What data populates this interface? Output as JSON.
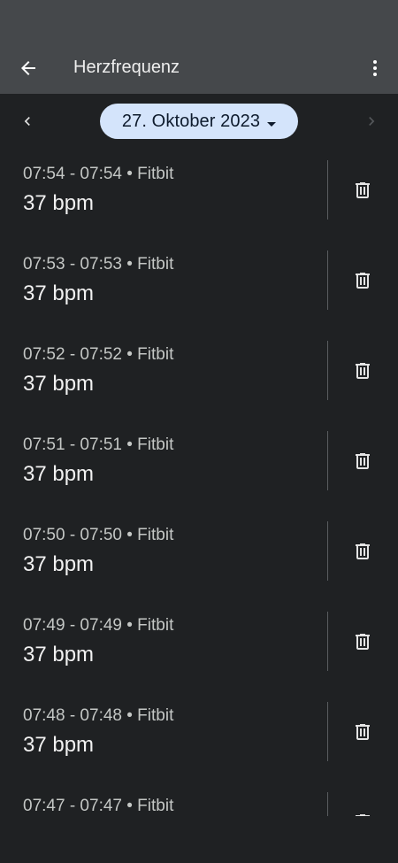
{
  "app_bar": {
    "title": "Herzfrequenz",
    "back_icon": "arrow-back-icon",
    "menu_icon": "more-vert-icon"
  },
  "date_nav": {
    "date_label": "27. Oktober 2023",
    "prev_icon": "chevron-left-icon",
    "next_icon": "chevron-right-icon",
    "next_enabled": false
  },
  "colors": {
    "background": "#1f2123",
    "app_bar": "#45484b",
    "chip": "#d4e4fb"
  },
  "entries": [
    {
      "time_source": "07:54 - 07:54 • Fitbit",
      "value": "37 bpm"
    },
    {
      "time_source": "07:53 - 07:53 • Fitbit",
      "value": "37 bpm"
    },
    {
      "time_source": "07:52 - 07:52 • Fitbit",
      "value": "37 bpm"
    },
    {
      "time_source": "07:51 - 07:51 • Fitbit",
      "value": "37 bpm"
    },
    {
      "time_source": "07:50 - 07:50 • Fitbit",
      "value": "37 bpm"
    },
    {
      "time_source": "07:49 - 07:49 • Fitbit",
      "value": "37 bpm"
    },
    {
      "time_source": "07:48 - 07:48 • Fitbit",
      "value": "37 bpm"
    },
    {
      "time_source": "07:47 - 07:47 • Fitbit",
      "value": ""
    }
  ]
}
